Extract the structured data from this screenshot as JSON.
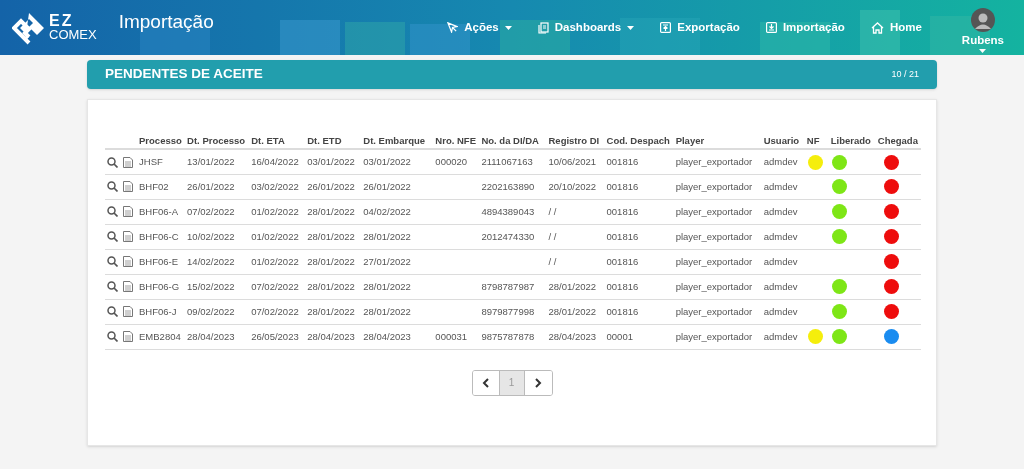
{
  "header": {
    "logo_top": "EZ",
    "logo_bottom": "COMEX",
    "title": "Importação",
    "nav": [
      {
        "kind": "cursor",
        "label": "Ações",
        "dropdown": true
      },
      {
        "kind": "dashboards",
        "label": "Dashboards",
        "dropdown": true
      },
      {
        "kind": "upload",
        "label": "Exportação",
        "dropdown": false
      },
      {
        "kind": "download",
        "label": "Importação",
        "dropdown": false
      },
      {
        "kind": "home",
        "label": "Home",
        "dropdown": false
      }
    ],
    "user": {
      "name": "Rubens"
    }
  },
  "panel": {
    "title": "PENDENTES DE ACEITE",
    "count": "10 / 21"
  },
  "table": {
    "columns": [
      "Processo",
      "Dt. Processo",
      "Dt. ETA",
      "Dt. ETD",
      "Dt. Embarque",
      "Nro. NFE",
      "No. da DI/DA",
      "Registro DI",
      "Cod. Despach",
      "Player",
      "Usuario",
      "NF",
      "Liberado",
      "Chegada"
    ],
    "rows": [
      {
        "cells": [
          "JHSF",
          "13/01/2022",
          "16/04/2022",
          "03/01/2022",
          "03/01/2022",
          "000020",
          "2111067163",
          "10/06/2021",
          "001816",
          "player_exportador",
          "admdev"
        ],
        "nf": {
          "color": "#f5ee0c"
        },
        "liberado": {
          "color": "#7ee616"
        },
        "chegada": {
          "color": "#ee0d0d"
        }
      },
      {
        "cells": [
          "BHF02",
          "26/01/2022",
          "03/02/2022",
          "26/01/2022",
          "26/01/2022",
          "",
          "2202163890",
          "20/10/2022",
          "001816",
          "player_exportador",
          "admdev"
        ],
        "liberado": {
          "color": "#7ee616"
        },
        "chegada": {
          "color": "#ee0d0d"
        }
      },
      {
        "cells": [
          "BHF06-A",
          "07/02/2022",
          "01/02/2022",
          "28/01/2022",
          "04/02/2022",
          "",
          "4894389043",
          "/ /",
          "001816",
          "player_exportador",
          "admdev"
        ],
        "liberado": {
          "color": "#7ee616"
        },
        "chegada": {
          "color": "#ee0d0d"
        }
      },
      {
        "cells": [
          "BHF06-C",
          "10/02/2022",
          "01/02/2022",
          "28/01/2022",
          "28/01/2022",
          "",
          "2012474330",
          "/ /",
          "001816",
          "player_exportador",
          "admdev"
        ],
        "liberado": {
          "color": "#7ee616"
        },
        "chegada": {
          "color": "#ee0d0d"
        }
      },
      {
        "cells": [
          "BHF06-E",
          "14/02/2022",
          "01/02/2022",
          "28/01/2022",
          "27/01/2022",
          "",
          "",
          "/ /",
          "001816",
          "player_exportador",
          "admdev"
        ],
        "chegada": {
          "color": "#ee0d0d"
        }
      },
      {
        "cells": [
          "BHF06-G",
          "15/02/2022",
          "07/02/2022",
          "28/01/2022",
          "28/01/2022",
          "",
          "8798787987",
          "28/01/2022",
          "001816",
          "player_exportador",
          "admdev"
        ],
        "liberado": {
          "color": "#7ee616"
        },
        "chegada": {
          "color": "#ee0d0d"
        }
      },
      {
        "cells": [
          "BHF06-J",
          "09/02/2022",
          "07/02/2022",
          "28/01/2022",
          "28/01/2022",
          "",
          "8979877998",
          "28/01/2022",
          "001816",
          "player_exportador",
          "admdev"
        ],
        "liberado": {
          "color": "#7ee616"
        },
        "chegada": {
          "color": "#ee0d0d"
        }
      },
      {
        "cells": [
          "EMB2804",
          "28/04/2023",
          "26/05/2023",
          "28/04/2023",
          "28/04/2023",
          "000031",
          "9875787878",
          "28/04/2023",
          "00001",
          "player_exportador",
          "admdev"
        ],
        "nf": {
          "color": "#f5ee0c"
        },
        "liberado": {
          "color": "#7ee616"
        },
        "chegada": {
          "color": "#1a8cf0"
        }
      }
    ]
  },
  "pagination": {
    "pages": [
      {
        "label": "1",
        "selected": true
      }
    ]
  }
}
